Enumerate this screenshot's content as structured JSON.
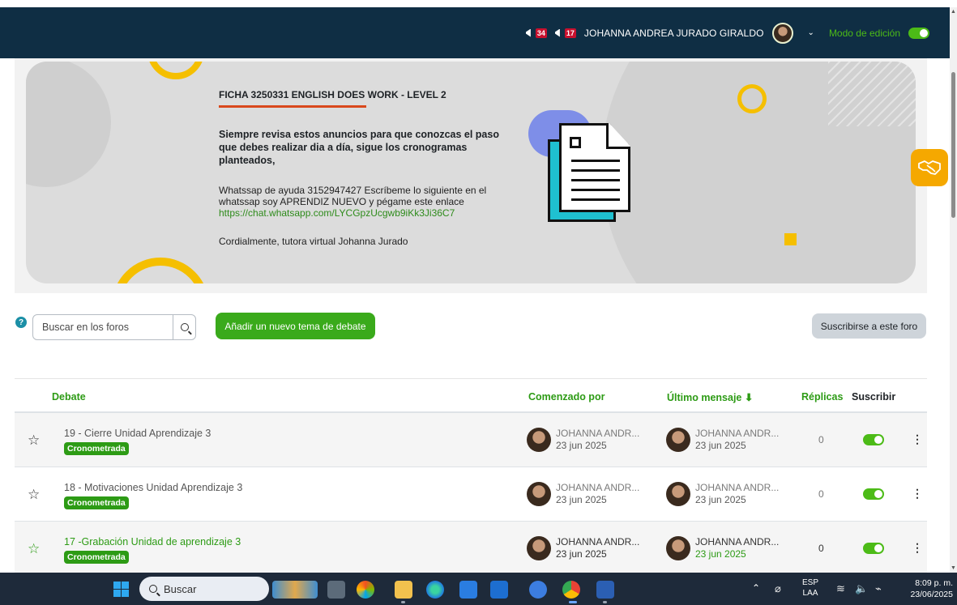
{
  "navbar": {
    "badge_messages": "34",
    "badge_notifications": "17",
    "user_name": "JOHANNA ANDREA JURADO GIRALDO",
    "edit_mode_label": "Modo de edición",
    "edit_mode_on": true
  },
  "banner": {
    "title": "FICHA 3250331 ENGLISH DOES WORK - LEVEL 2",
    "strong_text": "Siempre revisa estos anuncios para que conozcas el paso que debes realizar dia a día, sigue los cronogramas planteados,",
    "help_text": "Whatssap de ayuda 3152947427 Escríbeme lo siguiente en el whatssap soy APRENDIZ NUEVO y pégame este enlace ",
    "help_link": "https://chat.whatsapp.com/LYCGpzUcgwb9iKk3Ji36C7",
    "signature": "Cordialmente, tutora virtual Johanna Jurado"
  },
  "controls": {
    "search_placeholder": "Buscar en los foros",
    "add_topic_label": "Añadir un nuevo tema de debate",
    "subscribe_forum_label": "Suscribirse a este foro"
  },
  "table": {
    "headers": {
      "debate": "Debate",
      "started_by": "Comenzado por",
      "last_post": "Último mensaje",
      "replies": "Réplicas",
      "subscribe": "Suscribir"
    },
    "rows": [
      {
        "title": "19 - Cierre Unidad Aprendizaje 3",
        "tag": "Cronometrada",
        "starter_name": "JOHANNA ANDR...",
        "starter_date": "23 jun 2025",
        "last_name": "JOHANNA ANDR...",
        "last_date": "23 jun 2025",
        "replies": "0",
        "subscribed": true
      },
      {
        "title": "18 - Motivaciones Unidad Aprendizaje 3",
        "tag": "Cronometrada",
        "starter_name": "JOHANNA ANDR...",
        "starter_date": "23 jun 2025",
        "last_name": "JOHANNA ANDR...",
        "last_date": "23 jun 2025",
        "replies": "0",
        "subscribed": true
      },
      {
        "title": "17 -Grabación Unidad de aprendizaje 3",
        "tag": "Cronometrada",
        "starter_name": "JOHANNA ANDR...",
        "starter_date": "23 jun 2025",
        "last_name": "JOHANNA ANDR...",
        "last_date": "23 jun 2025",
        "replies": "0",
        "subscribed": true
      }
    ]
  },
  "taskbar": {
    "search_label": "Buscar",
    "lang_top": "ESP",
    "lang_bottom": "LAA",
    "time": "8:09 p. m.",
    "date": "23/06/2025"
  },
  "colors": {
    "navbar": "#0f2e44",
    "accent_green": "#3aaa1b",
    "banner_bg": "#dcdcdc",
    "yellow": "#f5bf00",
    "handshake": "#f5a800"
  }
}
